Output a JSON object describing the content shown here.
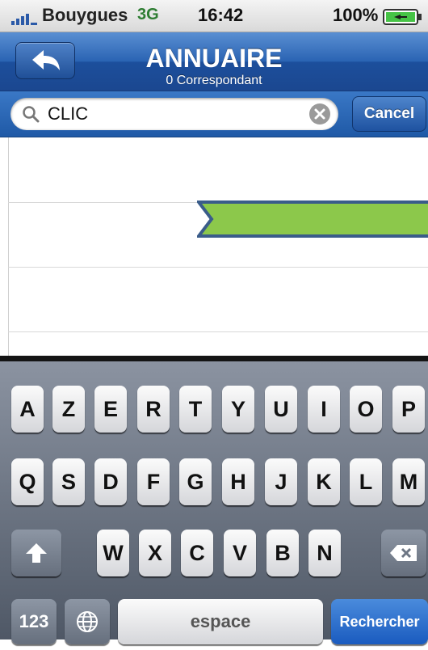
{
  "status_bar": {
    "carrier": "Bouygues",
    "network": "3G",
    "time": "16:42",
    "battery_percent": "100%"
  },
  "nav_bar": {
    "title": "ANNUAIRE",
    "subtitle": "0 Correspondant",
    "back_icon": "back-arrow-icon"
  },
  "search": {
    "value": "CLIC",
    "cancel_label": "Cancel",
    "icons": [
      "search-icon",
      "clear-icon"
    ]
  },
  "results": {
    "count": 0,
    "overlay_icon": "arrow-banner-icon"
  },
  "keyboard": {
    "row1": [
      "A",
      "Z",
      "E",
      "R",
      "T",
      "Y",
      "U",
      "I",
      "O",
      "P"
    ],
    "row2": [
      "Q",
      "S",
      "D",
      "F",
      "G",
      "H",
      "J",
      "K",
      "L",
      "M"
    ],
    "row3": [
      "W",
      "X",
      "C",
      "V",
      "B",
      "N"
    ],
    "numbers_label": "123",
    "space_label": "espace",
    "return_label": "Rechercher",
    "icons": [
      "shift-icon",
      "delete-icon",
      "globe-icon"
    ]
  },
  "colors": {
    "nav_blue": "#2a63b3",
    "arrow_green": "#8cc84b",
    "arrow_border": "#3a5c8a",
    "return_blue": "#1a5bbf"
  }
}
